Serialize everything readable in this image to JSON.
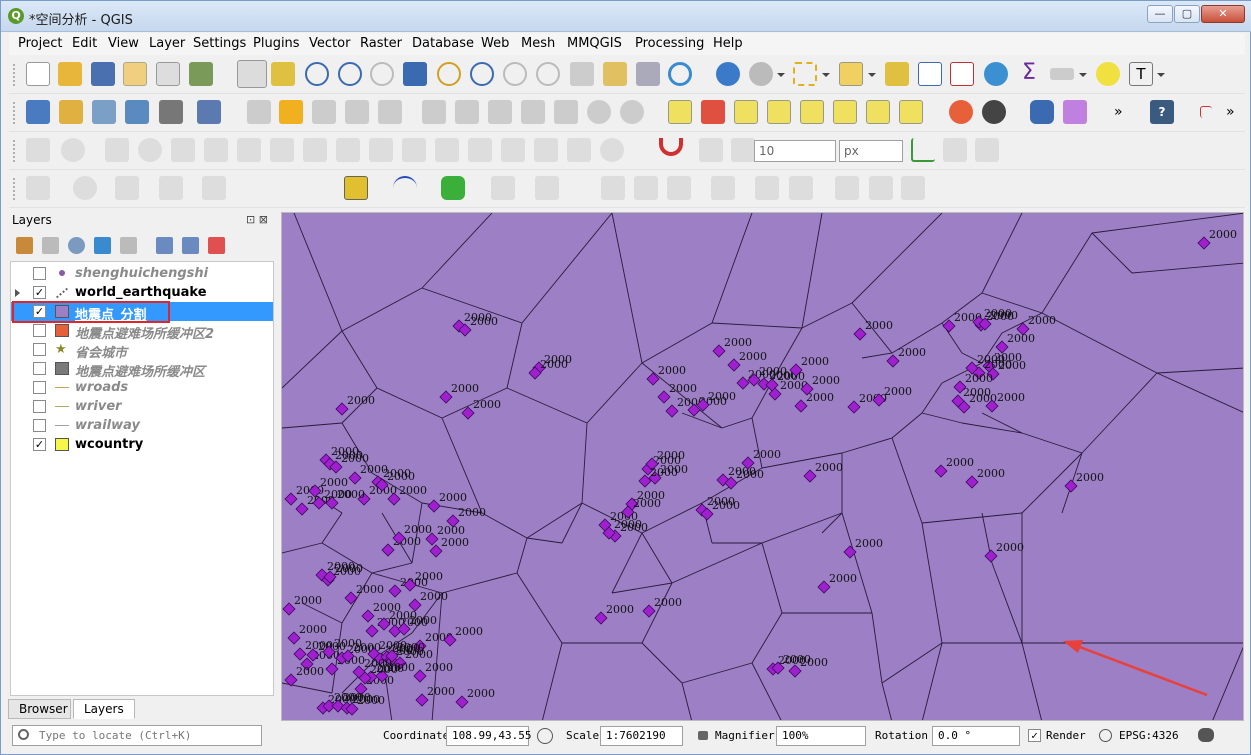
{
  "window": {
    "title": "*空间分析 - QGIS",
    "logo": "Q",
    "btn_min": "—",
    "btn_max": "▢",
    "btn_close": "✕"
  },
  "menu": [
    "Project",
    "Edit",
    "View",
    "Layer",
    "Settings",
    "Plugins",
    "Vector",
    "Raster",
    "Database",
    "Web",
    "Mesh",
    "MMQGIS",
    "Processing",
    "Help"
  ],
  "snapping": {
    "tolerance": "10",
    "unit": "px"
  },
  "layers_panel": {
    "title": "Layers",
    "dock_icons": "⊡ ⊠",
    "layers": [
      {
        "name": "shenghuichengshi",
        "checked": false,
        "style": "dim",
        "symbol": "dot",
        "color": "#8a5aa8",
        "expandable": false
      },
      {
        "name": "world_earthquake",
        "checked": true,
        "style": "bold",
        "symbol": "points",
        "color": "#666666",
        "expandable": true
      },
      {
        "name": "地震点_分割",
        "checked": true,
        "style": "sel",
        "symbol": "fill",
        "color": "#9c7fc4",
        "expandable": false,
        "selected": true
      },
      {
        "name": "地震点避难场所缓冲区2",
        "checked": false,
        "style": "dim",
        "symbol": "fill",
        "color": "#e6603a",
        "expandable": false
      },
      {
        "name": "省会城市",
        "checked": false,
        "style": "dim",
        "symbol": "star",
        "color": "#8a8a2a",
        "expandable": false
      },
      {
        "name": "地震点避难场所缓冲区",
        "checked": false,
        "style": "dim",
        "symbol": "fill",
        "color": "#7a7a7a",
        "expandable": false
      },
      {
        "name": "wroads",
        "checked": false,
        "style": "dim",
        "symbol": "line",
        "color": "#c8a060",
        "expandable": false
      },
      {
        "name": "wriver",
        "checked": false,
        "style": "dim",
        "symbol": "line",
        "color": "#a0b060",
        "expandable": false
      },
      {
        "name": "wrailway",
        "checked": false,
        "style": "dim",
        "symbol": "line",
        "color": "#a0a0a0",
        "expandable": false
      },
      {
        "name": "wcountry",
        "checked": true,
        "style": "bold",
        "symbol": "fill",
        "color": "#f7f74a",
        "expandable": false
      }
    ],
    "tabs": [
      "Browser",
      "Layers"
    ]
  },
  "map": {
    "background": "#9c7fc4",
    "point_color": "#a020d0",
    "label": "2000",
    "annotation_arrow_color": "#e8403a"
  },
  "status": {
    "locate_placeholder": "Type to locate (Ctrl+K)",
    "coordinate_label": "Coordinate",
    "coordinate_value": "108.99,43.55",
    "scale_label": "Scale",
    "scale_value": "1:7602190",
    "magnifier_label": "Magnifier",
    "magnifier_value": "100%",
    "rotation_label": "Rotation",
    "rotation_value": "0.0 °",
    "render_label": "Render",
    "render_checked": true,
    "crs": "EPSG:4326"
  }
}
